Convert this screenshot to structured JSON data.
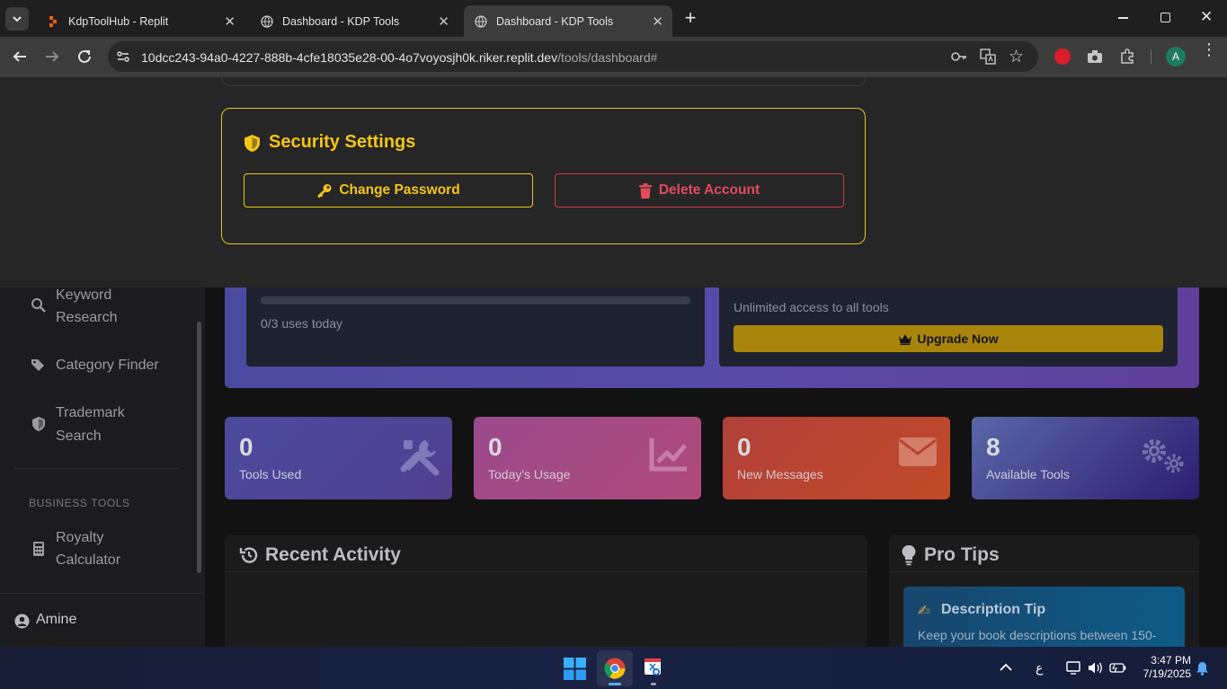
{
  "browser": {
    "tabs": [
      {
        "title": "KdpToolHub - Replit",
        "active": false
      },
      {
        "title": "Dashboard - KDP Tools",
        "active": false
      },
      {
        "title": "Dashboard - KDP Tools",
        "active": true
      }
    ],
    "url_main": "10dcc243-94a0-4227-888b-4cfe18035e28-00-4o7voyosjh0k.riker.replit.dev",
    "url_path": "/tools/dashboard#",
    "profile_initial": "A"
  },
  "sidebar": {
    "items": [
      {
        "label_line1": "Keyword",
        "label_line2": "Research",
        "icon": "search-icon"
      },
      {
        "label": "Category Finder",
        "icon": "tags-icon"
      },
      {
        "label_line1": "Trademark",
        "label_line2": "Search",
        "icon": "shield-icon"
      }
    ],
    "section_heading": "BUSINESS TOOLS",
    "business_items": [
      {
        "label_line1": "Royalty",
        "label_line2": "Calculator",
        "icon": "calculator-icon"
      }
    ],
    "user_name": "Amine"
  },
  "usage": {
    "uses_text": "0/3 uses today",
    "progress": 0
  },
  "pro": {
    "description": "Unlimited access to all tools",
    "upgrade_label": "Upgrade Now"
  },
  "stats": [
    {
      "value": "0",
      "label": "Tools Used",
      "icon": "tools-icon"
    },
    {
      "value": "0",
      "label": "Today's Usage",
      "icon": "chart-line-icon"
    },
    {
      "value": "0",
      "label": "New Messages",
      "icon": "envelope-icon"
    },
    {
      "value": "8",
      "label": "Available Tools",
      "icon": "cogs-icon"
    }
  ],
  "recent_activity": {
    "title": "Recent Activity"
  },
  "pro_tips": {
    "title": "Pro Tips",
    "tip_title": "Description Tip",
    "tip_text": "Keep your book descriptions between 150-"
  },
  "security": {
    "title": "Security Settings",
    "change_password_label": "Change Password",
    "delete_account_label": "Delete Account"
  },
  "taskbar": {
    "time": "3:47 PM",
    "date": "7/19/2025",
    "lang": "ع"
  },
  "colors": {
    "accent_yellow": "#f5c518",
    "danger_red": "#d23a4d",
    "upgrade_bg": "#a9860b"
  }
}
